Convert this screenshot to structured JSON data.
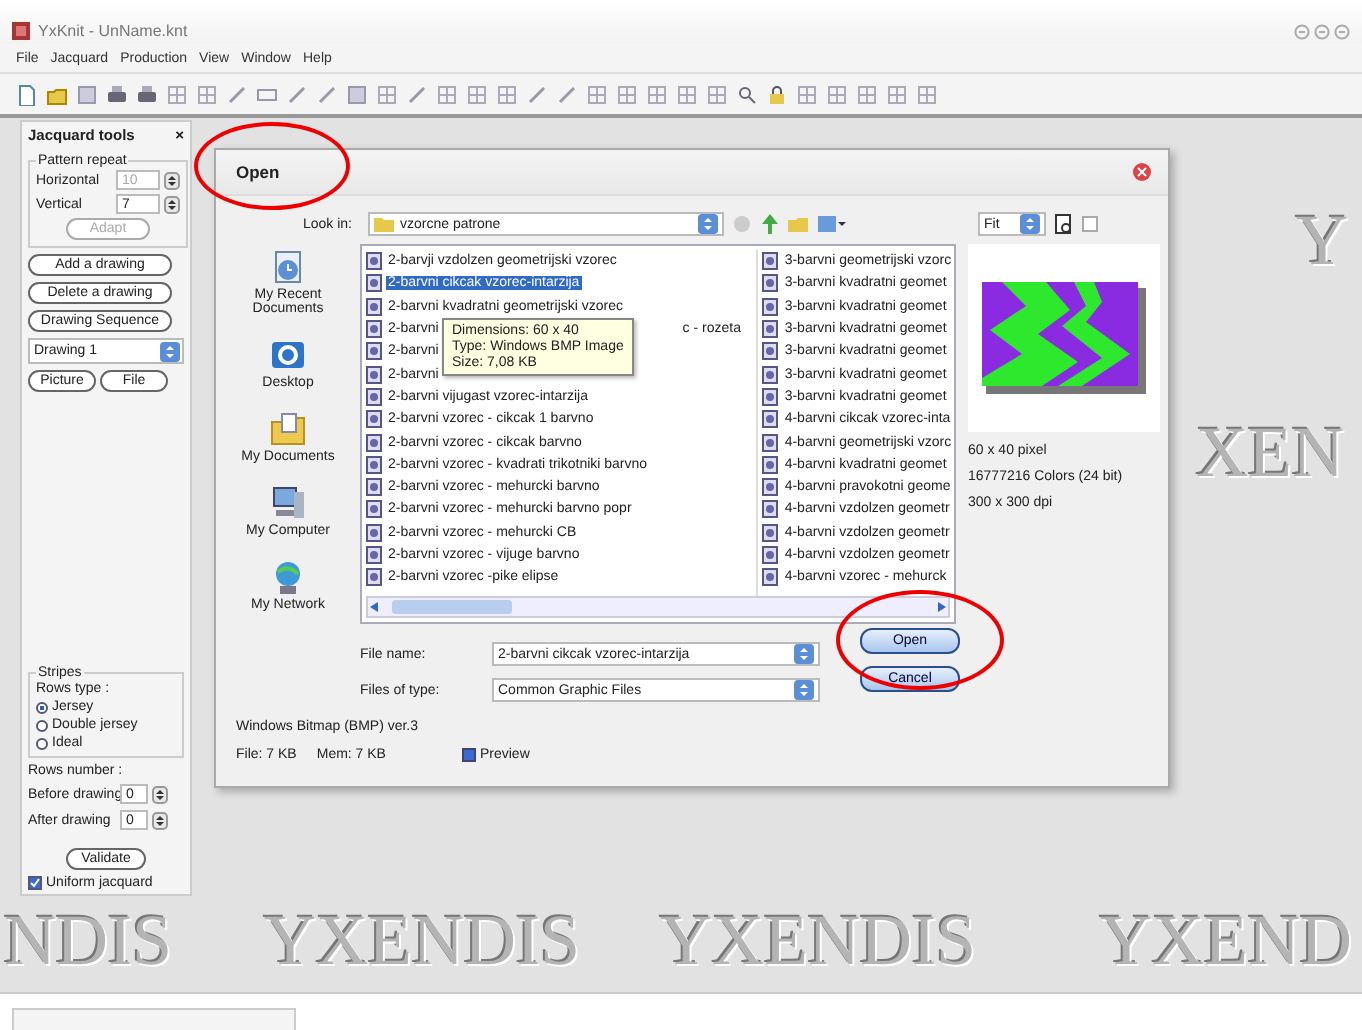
{
  "window": {
    "title": "YxKnit - UnName.knt"
  },
  "menu": [
    {
      "label": "File"
    },
    {
      "label": "Jacquard"
    },
    {
      "label": "Production"
    },
    {
      "label": "View"
    },
    {
      "label": "Window"
    },
    {
      "label": "Help"
    }
  ],
  "background_logos": [
    {
      "text": "Y"
    },
    {
      "text": "XEN"
    },
    {
      "text": "NDIS"
    },
    {
      "text": "YXENDIS"
    },
    {
      "text": "YXENDIS"
    },
    {
      "text": "YXEND"
    }
  ],
  "jacquard_tools": {
    "title": "Jacquard tools",
    "close": "×",
    "pattern_repeat": {
      "title": "Pattern repeat",
      "fields": [
        {
          "label": "Horizontal",
          "value": "10",
          "disabled": true
        },
        {
          "label": "Vertical",
          "value": "7",
          "disabled": false
        }
      ],
      "adapt": {
        "label": "Adapt",
        "disabled": true
      }
    },
    "buttons": [
      {
        "label": "Add a drawing"
      },
      {
        "label": "Delete a drawing"
      },
      {
        "label": "Drawing Sequence"
      }
    ],
    "drawing_select": "Drawing 1",
    "source_buttons": [
      {
        "label": "Picture"
      },
      {
        "label": "File"
      }
    ],
    "stripes": {
      "title": "Stripes",
      "rows_type_label": "Rows type :",
      "options": [
        {
          "label": "Jersey",
          "selected": true
        },
        {
          "label": "Double jersey",
          "selected": false
        },
        {
          "label": "Ideal",
          "selected": false
        }
      ]
    },
    "rows_number": {
      "label": "Rows number :",
      "fields": [
        {
          "label": "Before drawing",
          "value": "0"
        },
        {
          "label": "After drawing",
          "value": "0"
        }
      ]
    },
    "validate": "Validate",
    "uniform": {
      "label": "Uniform jacquard",
      "checked": true
    }
  },
  "open_dialog": {
    "title": "Open",
    "look_in": {
      "label": "Look in:",
      "value": "vzorcne patrone"
    },
    "places": [
      {
        "kind": "recent",
        "label": "My Recent Documents"
      },
      {
        "kind": "desktop",
        "label": "Desktop"
      },
      {
        "kind": "documents",
        "label": "My Documents"
      },
      {
        "kind": "computer",
        "label": "My Computer"
      },
      {
        "kind": "network",
        "label": "My Network"
      }
    ],
    "file_columns": [
      [
        {
          "label": "2-barvji vzdolzen geometrijski vzorec",
          "selected": false
        },
        {
          "label": "2-barvni cikcak vzorec-intarzija",
          "selected": true
        },
        {
          "label": "2-barvni kvadratni geometrijski vzorec",
          "selected": false
        },
        {
          "label": "2-barvni",
          "tail": "c - rozeta",
          "selected": false
        },
        {
          "label": "2-barvni",
          "selected": false
        },
        {
          "label": "2-barvni",
          "selected": false
        },
        {
          "label": "2-barvni vijugast vzorec-intarzija",
          "selected": false
        },
        {
          "label": "2-barvni vzorec - cikcak 1 barvno",
          "selected": false
        },
        {
          "label": "2-barvni vzorec - cikcak barvno",
          "selected": false
        },
        {
          "label": "2-barvni vzorec - kvadrati trikotniki barvno",
          "selected": false
        },
        {
          "label": "2-barvni vzorec - mehurcki barvno",
          "selected": false
        },
        {
          "label": "2-barvni vzorec - mehurcki barvno popr",
          "selected": false
        },
        {
          "label": "2-barvni vzorec - mehurcki CB",
          "selected": false
        },
        {
          "label": "2-barvni vzorec - vijuge barvno",
          "selected": false
        },
        {
          "label": "2-barvni vzorec -pike elipse",
          "selected": false
        }
      ],
      [
        {
          "label": "3-barvni geometrijski vzorc",
          "selected": false
        },
        {
          "label": "3-barvni kvadratni geomet",
          "selected": false
        },
        {
          "label": "3-barvni kvadratni geomet",
          "selected": false
        },
        {
          "label": "3-barvni kvadratni geomet",
          "selected": false
        },
        {
          "label": "3-barvni kvadratni geomet",
          "selected": false
        },
        {
          "label": "3-barvni kvadratni geomet",
          "selected": false
        },
        {
          "label": "3-barvni kvadratni geomet",
          "selected": false
        },
        {
          "label": "4-barvni cikcak vzorec-inta",
          "selected": false
        },
        {
          "label": "4-barvni geometrijski vzorc",
          "selected": false
        },
        {
          "label": "4-barvni kvadratni geomet",
          "selected": false
        },
        {
          "label": "4-barvni pravokotni geome",
          "selected": false
        },
        {
          "label": "4-barvni vzdolzen geometr",
          "selected": false
        },
        {
          "label": "4-barvni vzdolzen geometr",
          "selected": false
        },
        {
          "label": "4-barvni vzdolzen geometr",
          "selected": false
        },
        {
          "label": "4-barvni vzorec - mehurck",
          "selected": false
        }
      ]
    ],
    "tooltip": [
      "Dimensions: 60 x 40",
      "Type: Windows BMP Image",
      "Size: 7,08 KB"
    ],
    "preview": {
      "zoom": "Fit",
      "info": [
        "60 x 40 pixel",
        "16777216 Colors (24 bit)",
        "300 x 300 dpi"
      ]
    },
    "file_name": {
      "label": "File name:",
      "value": "2-barvni cikcak vzorec-intarzija"
    },
    "file_type": {
      "label": "Files of type:",
      "value": "Common Graphic Files"
    },
    "buttons": [
      {
        "label": "Open"
      },
      {
        "label": "Cancel"
      }
    ],
    "format": "Windows Bitmap (BMP) ver.3",
    "file_size": "File: 7 KB",
    "mem_size": "Mem: 7 KB",
    "preview_checkbox": {
      "label": "Preview",
      "checked": true
    }
  }
}
